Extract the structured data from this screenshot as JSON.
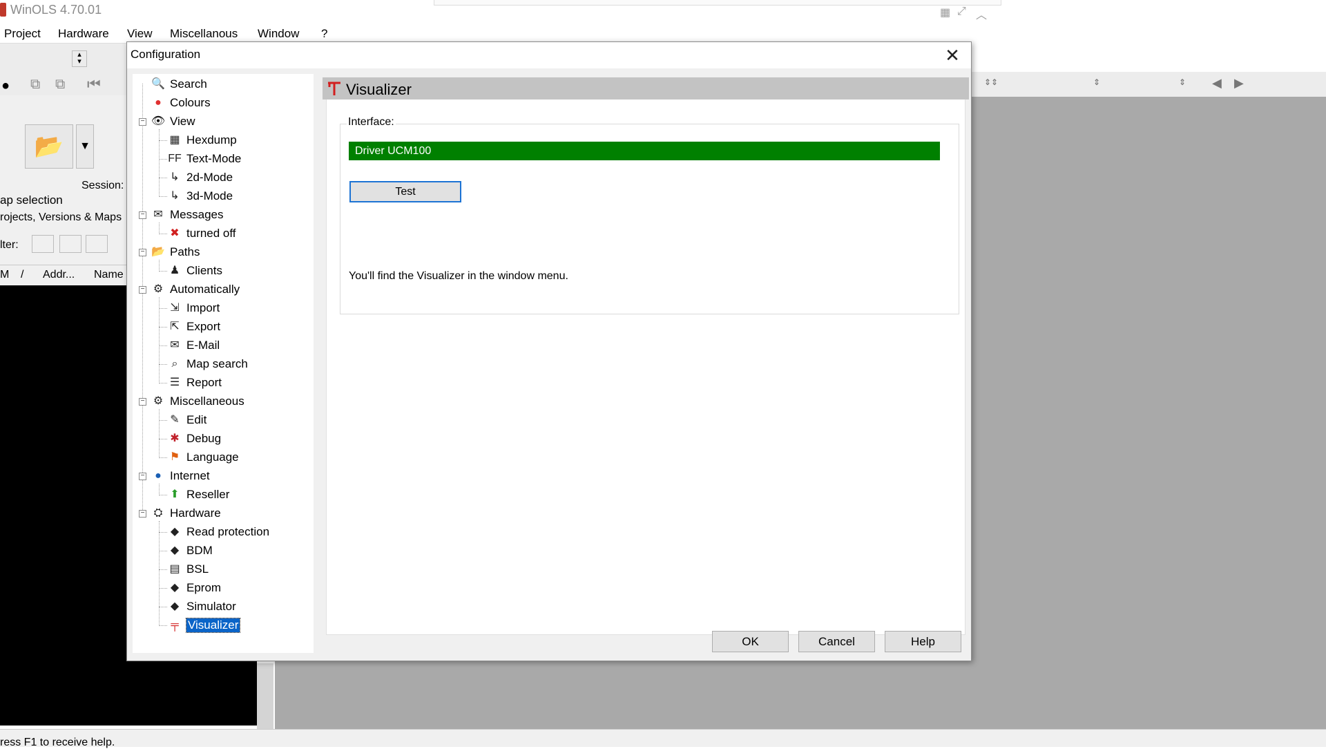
{
  "app": {
    "title": "WinOLS 4.70.01",
    "menu": [
      "Project",
      "Hardware",
      "View",
      "Miscellanous",
      "Window",
      "?"
    ],
    "left_panel": {
      "section_title": "ap selection",
      "session_label": "Session:",
      "projects_label": "rojects, Versions & Maps",
      "filter_label": "lter:",
      "columns": [
        "M",
        "/",
        "Addr...",
        "Name"
      ]
    },
    "status_text": "ress F1 to receive help."
  },
  "dialog": {
    "title": "Configuration",
    "close_symbol": "✕",
    "tree": [
      {
        "label": "Search",
        "icon": "search-icon",
        "level": 0
      },
      {
        "label": "Colours",
        "icon": "colours-icon",
        "level": 0
      },
      {
        "label": "View",
        "icon": "eye-icon",
        "level": 0,
        "expander": "−"
      },
      {
        "label": "Hexdump",
        "icon": "hexdump-icon",
        "level": 1
      },
      {
        "label": "Text-Mode",
        "icon": "text-mode-icon",
        "level": 1
      },
      {
        "label": "2d-Mode",
        "icon": "2d-mode-icon",
        "level": 1
      },
      {
        "label": "3d-Mode",
        "icon": "3d-mode-icon",
        "level": 1
      },
      {
        "label": "Messages",
        "icon": "messages-icon",
        "level": 0,
        "expander": "−"
      },
      {
        "label": "turned off",
        "icon": "turned-off-icon",
        "level": 1
      },
      {
        "label": "Paths",
        "icon": "folder-icon",
        "level": 0,
        "expander": "−"
      },
      {
        "label": "Clients",
        "icon": "clients-icon",
        "level": 1
      },
      {
        "label": "Automatically",
        "icon": "automatically-icon",
        "level": 0,
        "expander": "−"
      },
      {
        "label": "Import",
        "icon": "import-icon",
        "level": 1
      },
      {
        "label": "Export",
        "icon": "export-icon",
        "level": 1
      },
      {
        "label": "E-Mail",
        "icon": "email-icon",
        "level": 1
      },
      {
        "label": "Map search",
        "icon": "map-search-icon",
        "level": 1
      },
      {
        "label": "Report",
        "icon": "report-icon",
        "level": 1
      },
      {
        "label": "Miscellaneous",
        "icon": "miscellaneous-icon",
        "level": 0,
        "expander": "−"
      },
      {
        "label": "Edit",
        "icon": "edit-icon",
        "level": 1
      },
      {
        "label": "Debug",
        "icon": "debug-icon",
        "level": 1
      },
      {
        "label": "Language",
        "icon": "language-icon",
        "level": 1
      },
      {
        "label": "Internet",
        "icon": "globe-icon",
        "level": 0,
        "expander": "−"
      },
      {
        "label": "Reseller",
        "icon": "reseller-icon",
        "level": 1
      },
      {
        "label": "Hardware",
        "icon": "hardware-icon",
        "level": 0,
        "expander": "−"
      },
      {
        "label": "Read protection",
        "icon": "chip-icon",
        "level": 1
      },
      {
        "label": "BDM",
        "icon": "chip-icon",
        "level": 1
      },
      {
        "label": "BSL",
        "icon": "bsl-icon",
        "level": 1
      },
      {
        "label": "Eprom",
        "icon": "chip-icon",
        "level": 1
      },
      {
        "label": "Simulator",
        "icon": "simulator-icon",
        "level": 1
      },
      {
        "label": "Visualizer",
        "icon": "visualizer-icon",
        "level": 1,
        "selected": true
      }
    ],
    "page": {
      "title": "Visualizer",
      "interface_label": "Interface:",
      "interface_value": "Driver UCM100",
      "test_button": "Test",
      "info": "You'll find the Visualizer in the window menu."
    },
    "buttons": {
      "ok": "OK",
      "cancel": "Cancel",
      "help": "Help"
    }
  },
  "colors": {
    "driver_bar": "#008000",
    "selection": "#0a64c8",
    "page_header": "#c3c3c3"
  }
}
